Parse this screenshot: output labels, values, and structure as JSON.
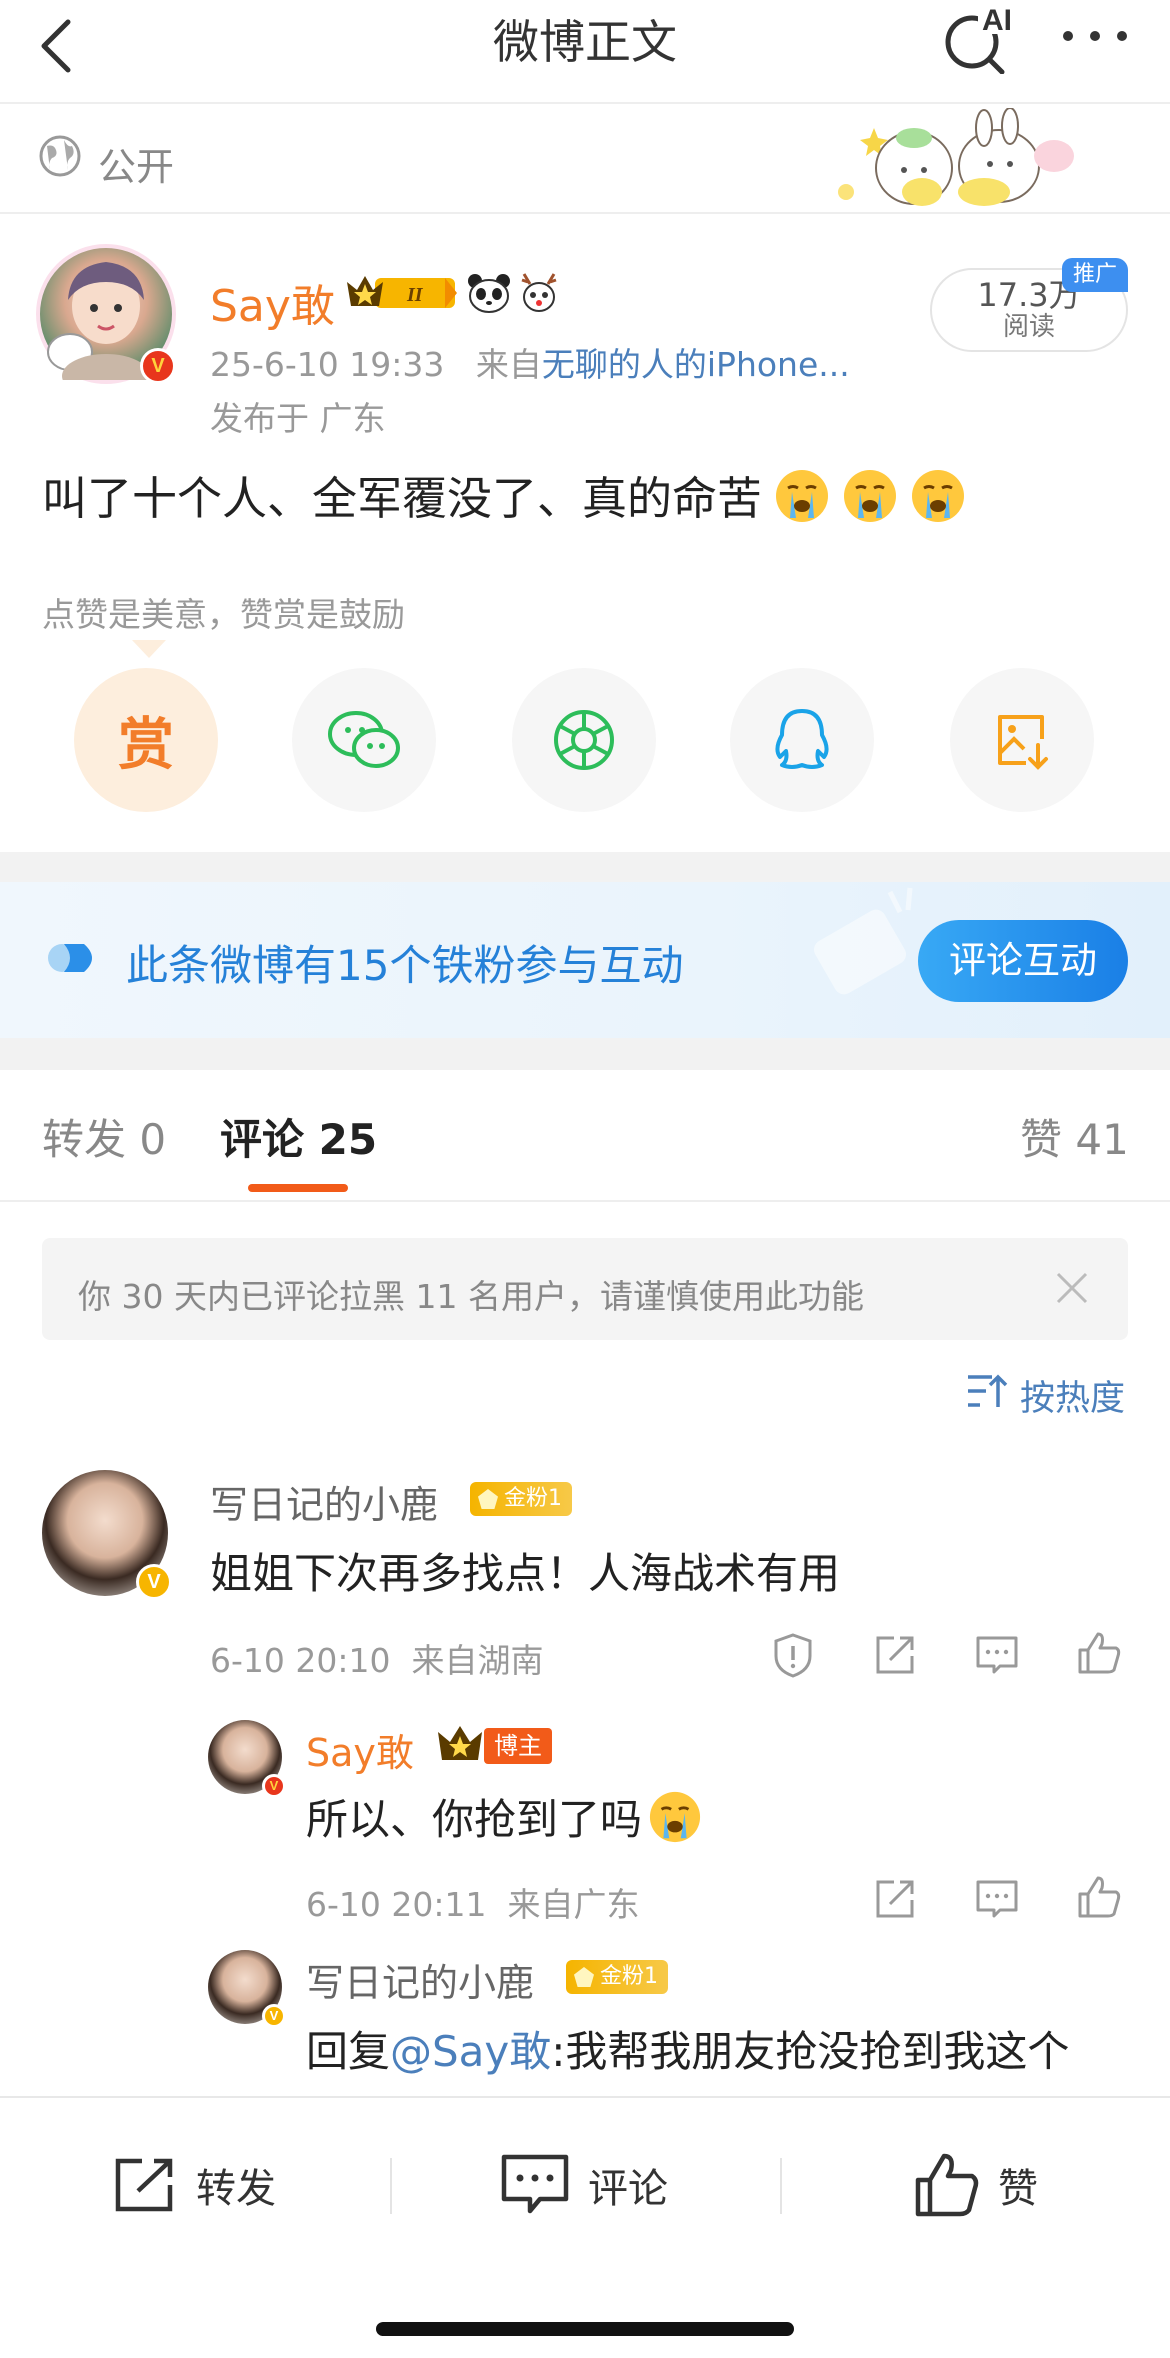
{
  "header": {
    "title": "微博正文",
    "ai_label": "AI"
  },
  "visibility": {
    "label": "公开"
  },
  "post": {
    "author": "Say敢",
    "level_badge": "II",
    "time": "25-6-10 19:33",
    "source_prefix": "来自",
    "source": "无聊的人的iPhone...",
    "location": "发布于 广东",
    "reads": "17.3万",
    "reads_label": "阅读",
    "promo_tag": "推广",
    "text": "叫了十个人、全军覆没了、真的命苦",
    "reward_tip": "点赞是美意，赞赏是鼓励",
    "reward_label": "赏"
  },
  "share_icons": [
    "reward-icon",
    "wechat-icon",
    "moments-icon",
    "qq-icon",
    "save-image-icon"
  ],
  "fans_banner": {
    "text": "此条微博有15个铁粉参与互动",
    "button": "评论互动"
  },
  "tabs": {
    "repost": "转发 0",
    "comment": "评论 25",
    "like": "赞 41"
  },
  "notice": {
    "text": "你 30 天内已评论拉黑 11 名用户，请谨慎使用此功能"
  },
  "sort": {
    "label": "按热度"
  },
  "comments": [
    {
      "name": "写日记的小鹿",
      "badge": "金粉1",
      "text": "姐姐下次再多找点！人海战术有用",
      "time": "6-10 20:10",
      "location": "来自湖南"
    },
    {
      "name": "Say敢",
      "badge": "博主",
      "text": "所以、你抢到了吗",
      "time": "6-10 20:11",
      "location": "来自广东"
    },
    {
      "name": "写日记的小鹿",
      "badge": "金粉1",
      "reply_prefix": "回复",
      "mention": "@Say敢",
      "text": ":我帮我朋友抢没抢到我这个"
    }
  ],
  "bottom_bar": {
    "repost": "转发",
    "comment": "评论",
    "like": "赞"
  },
  "colors": {
    "accent_orange": "#f27d2a",
    "link_blue": "#4b7fbb",
    "tab_underline": "#f25b19",
    "fan_badge_gold": "#f5b400"
  }
}
